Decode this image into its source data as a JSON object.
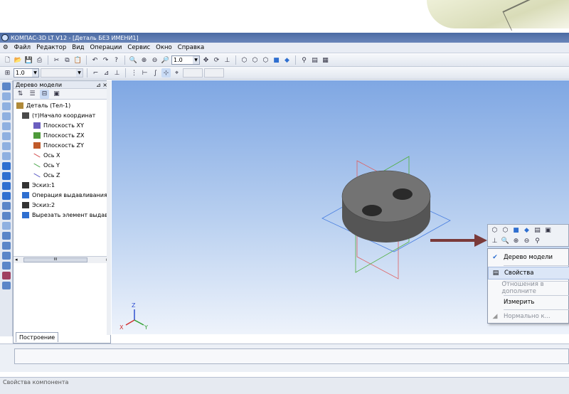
{
  "window": {
    "title": "КОМПАС-3D LT V12 - [Деталь БЕЗ ИМЕНИ1]"
  },
  "menu": [
    "Файл",
    "Редактор",
    "Вид",
    "Операции",
    "Сервис",
    "Окно",
    "Справка"
  ],
  "toolbar": {
    "zoom_value": "1.0",
    "step_value": "1.0"
  },
  "panel": {
    "title": "Дерево модели",
    "pin_close": "⊿ ×",
    "tab": "Построение",
    "tree": [
      {
        "label": "Деталь (Тел-1)",
        "icon": "part-icon",
        "color": "#b08a3a"
      },
      {
        "label": "(т)Начало координат",
        "icon": "origin-icon",
        "color": "#4a4a4a"
      },
      {
        "label": "Плоскость XY",
        "icon": "plane-icon",
        "color": "#6b5fbf"
      },
      {
        "label": "Плоскость ZX",
        "icon": "plane-icon",
        "color": "#4e9a3a"
      },
      {
        "label": "Плоскость ZY",
        "icon": "plane-icon",
        "color": "#c05a2a"
      },
      {
        "label": "Ось X",
        "icon": "axis-icon",
        "color": "#d04040"
      },
      {
        "label": "Ось Y",
        "icon": "axis-icon",
        "color": "#40a040"
      },
      {
        "label": "Ось Z",
        "icon": "axis-icon",
        "color": "#5050c0"
      },
      {
        "label": "Эскиз:1",
        "icon": "sketch-icon",
        "color": "#333"
      },
      {
        "label": "Операция выдавливания",
        "icon": "extrude-icon",
        "color": "#2f6fd0"
      },
      {
        "label": "Эскиз:2",
        "icon": "sketch-icon",
        "color": "#333"
      },
      {
        "label": "Вырезать элемент выдав.",
        "icon": "cut-icon",
        "color": "#2f6fd0"
      }
    ],
    "scroll_grip": "III"
  },
  "context_menu": {
    "items": [
      {
        "label": "Дерево модели",
        "icon": "check-icon",
        "state": "checked"
      },
      {
        "label": "Свойства",
        "icon": "properties-icon",
        "state": "selected"
      },
      {
        "label": "Отношения в дополните",
        "icon": "",
        "state": "disabled"
      },
      {
        "label": "Измерить",
        "icon": "",
        "state": "normal"
      },
      {
        "label": "Нормально к...",
        "icon": "normal-view-icon",
        "state": "disabled"
      }
    ]
  },
  "axes_triad": {
    "x": "X",
    "y": "Y",
    "z": "Z"
  },
  "status": {
    "text": "Свойства компонента"
  },
  "colors": {
    "accent": "#3a6fcf",
    "arrow": "#c0392b",
    "part": "#6c6c6c"
  }
}
